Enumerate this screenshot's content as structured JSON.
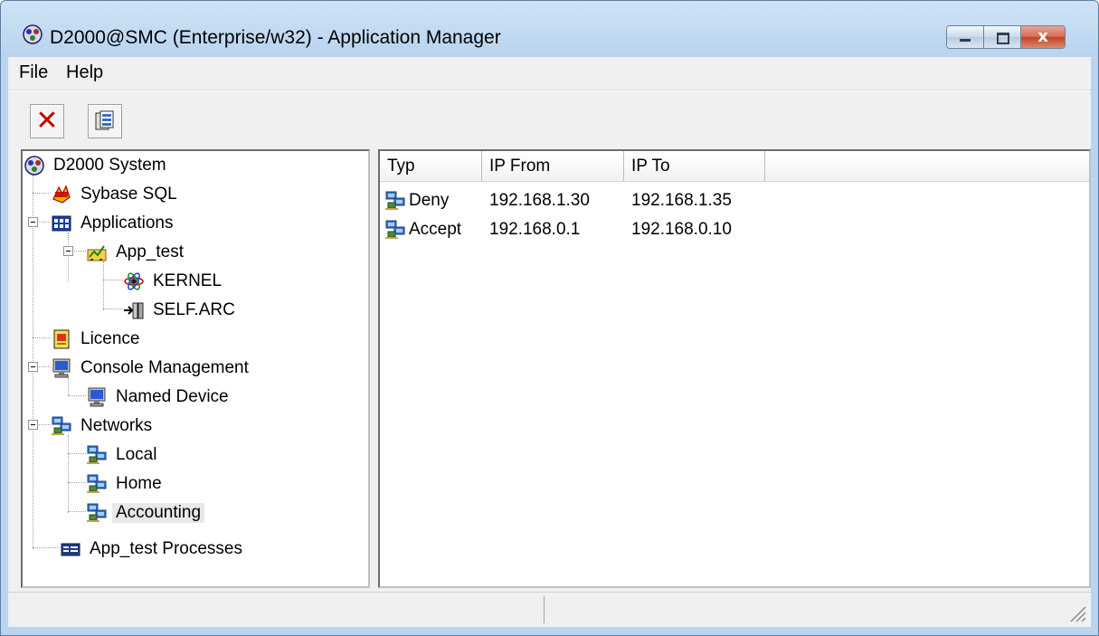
{
  "window": {
    "title": "D2000@SMC (Enterprise/w32) - Application Manager",
    "icon": "d2000-system-icon",
    "close_glyph": "x"
  },
  "menubar": {
    "items": [
      "File",
      "Help"
    ]
  },
  "toolbar": {
    "delete_glyph": "✕",
    "buttons": [
      "delete-icon",
      "process-list-icon"
    ]
  },
  "tree": {
    "root": "D2000 System",
    "nodes": {
      "sybase": "Sybase SQL",
      "applications": "Applications",
      "app_test": "App_test",
      "kernel": "KERNEL",
      "selfarc": "SELF.ARC",
      "licence": "Licence",
      "console": "Console Management",
      "named_device": "Named Device",
      "networks": "Networks",
      "local": "Local",
      "home": "Home",
      "accounting": "Accounting",
      "processes": "App_test Processes"
    },
    "selected": "Accounting"
  },
  "list": {
    "columns": [
      "Typ",
      "IP From",
      "IP To"
    ],
    "rows": [
      {
        "typ": "Deny",
        "ip_from": "192.168.1.30",
        "ip_to": "192.168.1.35"
      },
      {
        "typ": "Accept",
        "ip_from": "192.168.0.1",
        "ip_to": "192.168.0.10"
      }
    ]
  },
  "colors": {
    "title_bg": "#b9d4ef",
    "selection_bg": "#e8e8e8",
    "delete_red": "#c00000"
  }
}
